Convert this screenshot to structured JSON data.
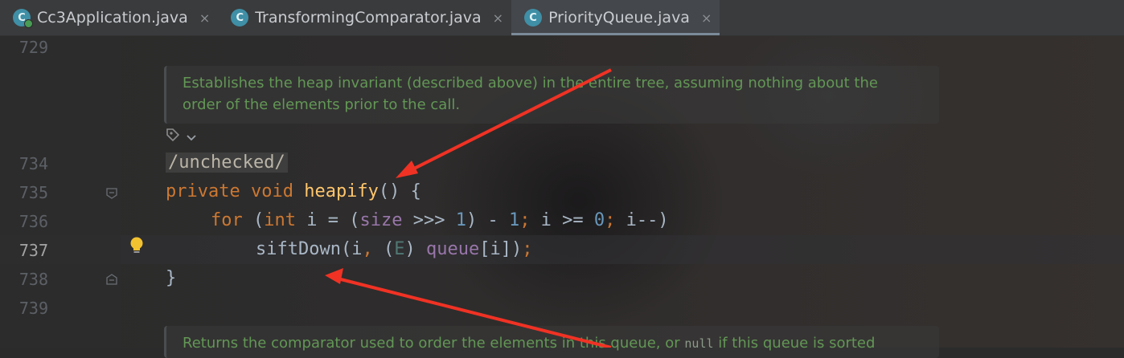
{
  "tabs": [
    {
      "icon": "C",
      "label": "Cc3Application.java",
      "close": "×",
      "run_badge": true
    },
    {
      "icon": "C",
      "label": "TransformingComparator.java",
      "close": "×",
      "run_badge": false
    },
    {
      "icon": "C",
      "label": "PriorityQueue.java",
      "close": "×",
      "active": true
    }
  ],
  "gutter": {
    "line_numbers": [
      "729",
      "734",
      "735",
      "736",
      "737",
      "738",
      "739"
    ],
    "current_line": "737"
  },
  "doc_blocks": {
    "first": {
      "line1": "Establishes the heap invariant (described above) in the entire tree, assuming nothing about the",
      "line2": "order of the elements prior to the call."
    },
    "second": {
      "before": "Returns the comparator used to order the elements in this queue, or ",
      "code": "null",
      "after": " if this queue is sorted"
    }
  },
  "code": {
    "annotation": "/unchecked/",
    "l735": {
      "kw1": "private",
      "kw2": "void",
      "name": "heapify",
      "rest": "() {"
    },
    "l736": {
      "kw_for": "for",
      "p1": " (",
      "kw_int": "int",
      "p2": " i = (",
      "field": "size",
      "p3": " >>> ",
      "n1": "1",
      "p4": ") - ",
      "n2": "1",
      "semi1": ";",
      "p5": " i >= ",
      "n3": "0",
      "semi2": ";",
      "p6": " i--)"
    },
    "l737": {
      "call": "siftDown",
      "p1": "(i",
      "comma": ",",
      "p2": " (",
      "type": "E",
      "p3": ") ",
      "field": "queue",
      "p4": "[i])",
      "semi": ";"
    },
    "l738": "}"
  },
  "icons": [
    "run-config-icon",
    "lightbulb-icon",
    "fold-marker-icon",
    "inlay-hint-icon"
  ],
  "colors": {
    "accent_arrow": "#f03224",
    "keyword": "#cc7832",
    "function": "#ffc66d",
    "field": "#9876aa",
    "number": "#6897bb",
    "doc": "#629755"
  }
}
